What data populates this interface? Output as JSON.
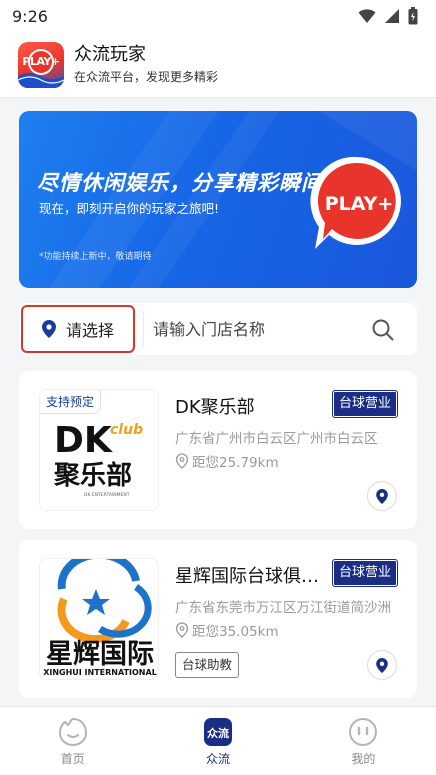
{
  "status_bar": {
    "time": "9:26"
  },
  "header": {
    "logo_text": "PLAY+",
    "title": "众流玩家",
    "subtitle": "在众流平台，发现更多精彩"
  },
  "banner": {
    "headline": "尽情休闲娱乐，分享精彩瞬间",
    "subline": "现在，即刻开启你的玩家之旅吧!",
    "note": "*功能持续上新中，敬请期待",
    "badge_text": "PLAY+"
  },
  "search": {
    "location_label": "请选择",
    "placeholder": "请输入门店名称",
    "value": ""
  },
  "stores": [
    {
      "tag": "支持预定",
      "name": "DK聚乐部",
      "badge": "台球营业",
      "address": "广东省广州市白云区广州市白云区",
      "distance": "距您25.79km",
      "logo_main": "DK",
      "logo_club": "club",
      "logo_cn": "聚乐部",
      "logo_small": "DK  ENTERTAINMENT"
    },
    {
      "name": "星辉国际台球俱乐部",
      "badge": "台球营业",
      "address": "广东省东莞市万江区万江街道简沙洲",
      "distance": "距您35.05km",
      "service": "台球助教",
      "logo_cn": "星辉国际",
      "logo_en": "XINGHUI INTERNATIONAL"
    }
  ],
  "bottom_nav": [
    {
      "label": "首页",
      "active": false
    },
    {
      "label": "众流",
      "active": true,
      "icon_text": "众流"
    },
    {
      "label": "我的",
      "active": false
    }
  ],
  "colors": {
    "brand_blue": "#1a2e86",
    "highlight_red": "#d9352b",
    "banner_blue": "#1766e6"
  }
}
